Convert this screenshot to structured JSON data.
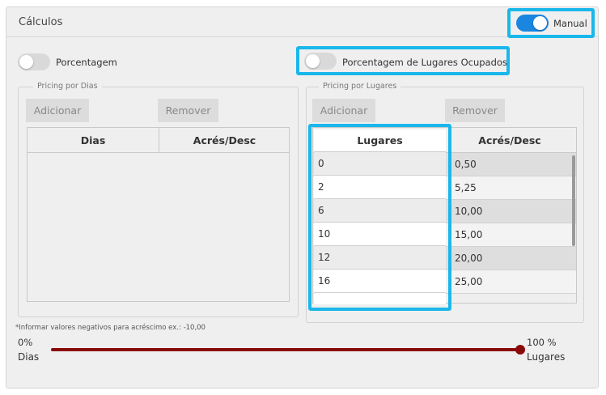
{
  "panel": {
    "title": "Cálculos"
  },
  "manual_toggle": {
    "label": "Manual",
    "state": "on"
  },
  "percent_toggle": {
    "label": "Porcentagem",
    "state": "off"
  },
  "occupied_toggle": {
    "label": "Porcentagem de Lugares Ocupados",
    "state": "off"
  },
  "pricing_days": {
    "legend": "Pricing por Dias",
    "add_label": "Adicionar",
    "remove_label": "Remover",
    "columns": [
      "Dias",
      "Acrés/Desc"
    ],
    "rows": []
  },
  "pricing_seats": {
    "legend": "Pricing por Lugares",
    "add_label": "Adicionar",
    "remove_label": "Remover",
    "columns": [
      "Lugares",
      "Acrés/Desc"
    ],
    "rows": [
      {
        "lugares": "0",
        "acres": "0,50"
      },
      {
        "lugares": "2",
        "acres": "5,25"
      },
      {
        "lugares": "6",
        "acres": "10,00"
      },
      {
        "lugares": "10",
        "acres": "15,00"
      },
      {
        "lugares": "12",
        "acres": "20,00"
      },
      {
        "lugares": "16",
        "acres": "25,00"
      }
    ]
  },
  "note": "*Informar valores negativos para acréscimo ex.: -10,00",
  "slider": {
    "left_value": "0%",
    "left_label": "Dias",
    "right_value": "100 %",
    "right_label": "Lugares",
    "value_percent": 100,
    "color": "#8a0a0a"
  },
  "colors": {
    "accent": "#1a86e0",
    "highlight": "#1ab7ea"
  }
}
